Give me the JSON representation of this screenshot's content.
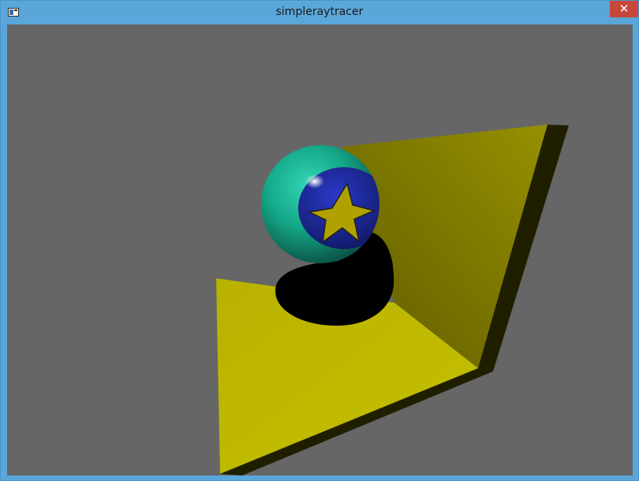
{
  "window": {
    "title": "simpleraytracer",
    "app_icon": "window-app-icon",
    "close_label": "✕"
  },
  "colors": {
    "titlebar": "#5aa6da",
    "close": "#c7473a",
    "canvas_background": "#666666",
    "plane_yellow": "#b3ad00",
    "wall_yellow": "#8a8500",
    "sphere_green": "#1fb396",
    "sphere_blue": "#1d2aa3",
    "star_yellow": "#b3a000",
    "shadow": "#000000"
  },
  "scene": {
    "objects": [
      "floor-plane",
      "back-wall",
      "sphere",
      "star-decal",
      "sphere-shadow"
    ]
  }
}
